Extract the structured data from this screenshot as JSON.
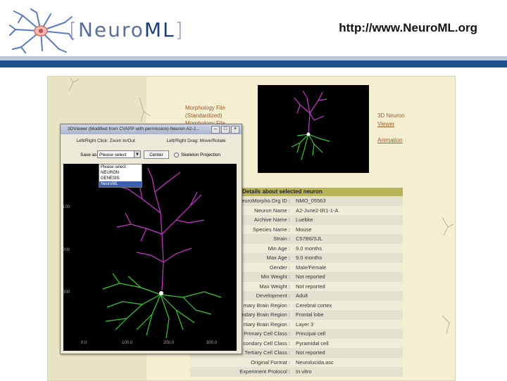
{
  "header": {
    "logo_text": "Neuro",
    "logo_text_ml": "ML",
    "url": "http://www.NeuroML.org"
  },
  "colors": {
    "header_bar": "#1d4f8c",
    "header_bar_light": "#b9c6d8",
    "neurite_dendrite": "#cc33cc",
    "neurite_basal": "#33cc33"
  },
  "side_links": {
    "morph_file": "Morphology File",
    "standardized": "(Standardized)",
    "morph_file2": "Morphology File",
    "neuron_viewer": "3D Neuron",
    "viewer_word": "Viewer",
    "animation": "Animation"
  },
  "details": {
    "title": "Details about selected neuron",
    "rows": [
      {
        "k": "euroMorpho.Org ID :",
        "v": "NMO_05563"
      },
      {
        "k": "Neuron Name :",
        "v": "A2-June2-IR1-1-A"
      },
      {
        "k": "Archive Name :",
        "v": "Luebke"
      },
      {
        "k": "Species Name :",
        "v": "Mouse"
      },
      {
        "k": "Strain :",
        "v": "C57B6/SJL"
      },
      {
        "k": "Min Age :",
        "v": "9.0 months"
      },
      {
        "k": "Max Age :",
        "v": "9.0 months"
      },
      {
        "k": "Gender :",
        "v": "Male/Female"
      },
      {
        "k": "Min Weight :",
        "v": "Not reported"
      },
      {
        "k": "Max Weight :",
        "v": "Not reported"
      },
      {
        "k": "Development :",
        "v": "Adult"
      },
      {
        "k": "mary Brain Region :",
        "v": "Cerebral cortex"
      },
      {
        "k": "ondary Brain Region :",
        "v": "Frontal lobe"
      },
      {
        "k": "rtiary Brain Region :",
        "v": "Layer 3"
      },
      {
        "k": "Primary Cell Class :",
        "v": "Principal cell"
      },
      {
        "k": "condary Cell Class :",
        "v": "Pyramidal cell"
      },
      {
        "k": "Tertiary Cell Class :",
        "v": "Not reported"
      },
      {
        "k": "Original Format :",
        "v": "Neurolucida.asc"
      },
      {
        "k": "Experiment Protocol :",
        "v": "In vitro"
      }
    ]
  },
  "viewer": {
    "title": "3DViewer (Modified from CVAPP with permission)-Neuron A2-J...",
    "instr_left": "Left/Right Click: Zoom In/Out",
    "instr_right": "Left/Right Drag: Move/Rotate",
    "save_label": "Save as:",
    "select_value": "Please select",
    "center_label": "Center",
    "skeleton_label": "Skeleton Projection",
    "options": [
      "Please select",
      "NEURON",
      "GENESIS",
      "NeuroML"
    ],
    "y_ticks": [
      "100",
      "200",
      "300"
    ],
    "x_ticks": [
      "0.0",
      "100.0",
      "200.0",
      "300.0"
    ]
  }
}
